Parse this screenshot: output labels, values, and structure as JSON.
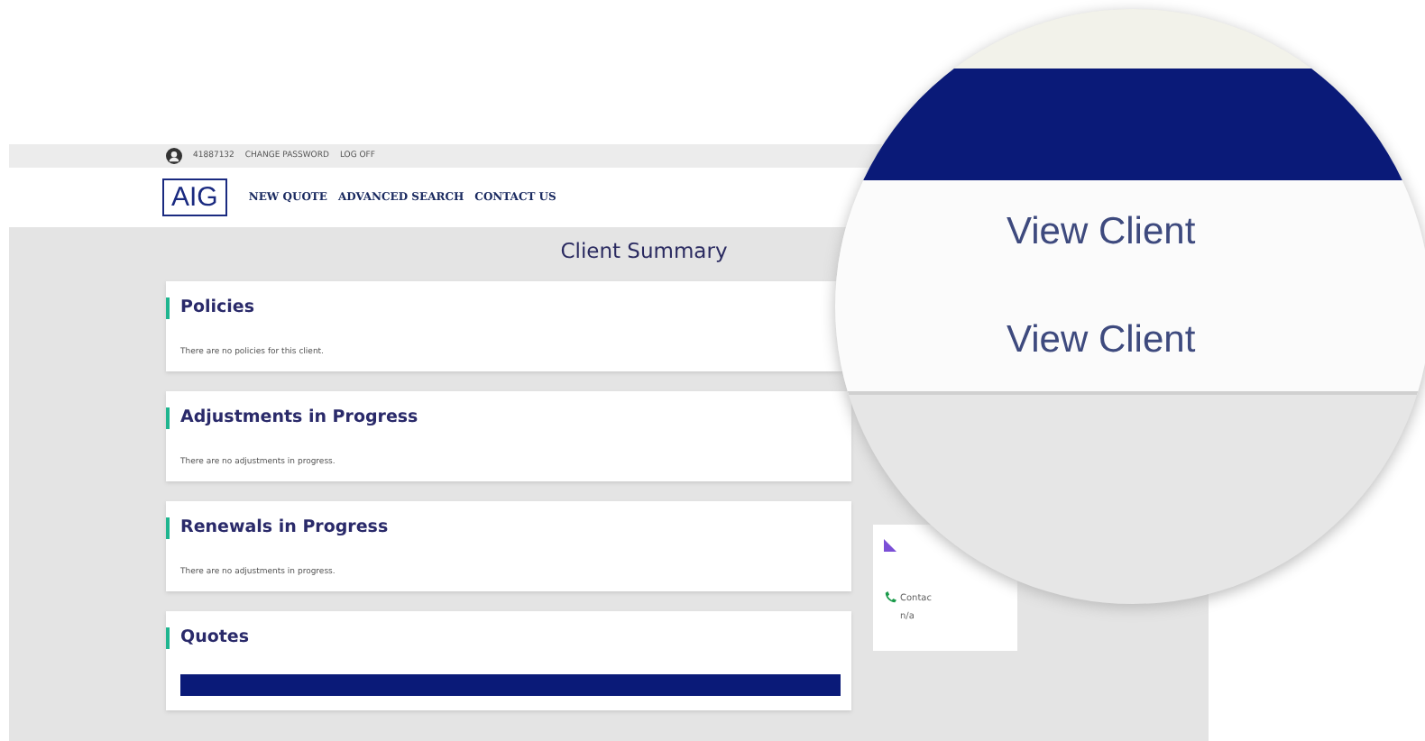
{
  "top_bar": {
    "user": "41887132",
    "links": [
      "CHANGE PASSWORD",
      "LOG OFF"
    ]
  },
  "header": {
    "logo": "AIG",
    "nav": [
      "NEW QUOTE",
      "ADVANCED SEARCH",
      "CONTACT US"
    ]
  },
  "page_title": "Client Summary",
  "sections": [
    {
      "title": "Policies",
      "message": "There are no policies for this client."
    },
    {
      "title": "Adjustments in Progress",
      "message": "There are no adjustments in progress."
    },
    {
      "title": "Renewals in Progress",
      "message": "There are no adjustments in progress."
    },
    {
      "title": "Quotes"
    }
  ],
  "side_card": {
    "contact_label": "Contac",
    "contact_value": "n/a"
  },
  "magnifier": {
    "links": [
      "View Client",
      "View Client"
    ]
  }
}
